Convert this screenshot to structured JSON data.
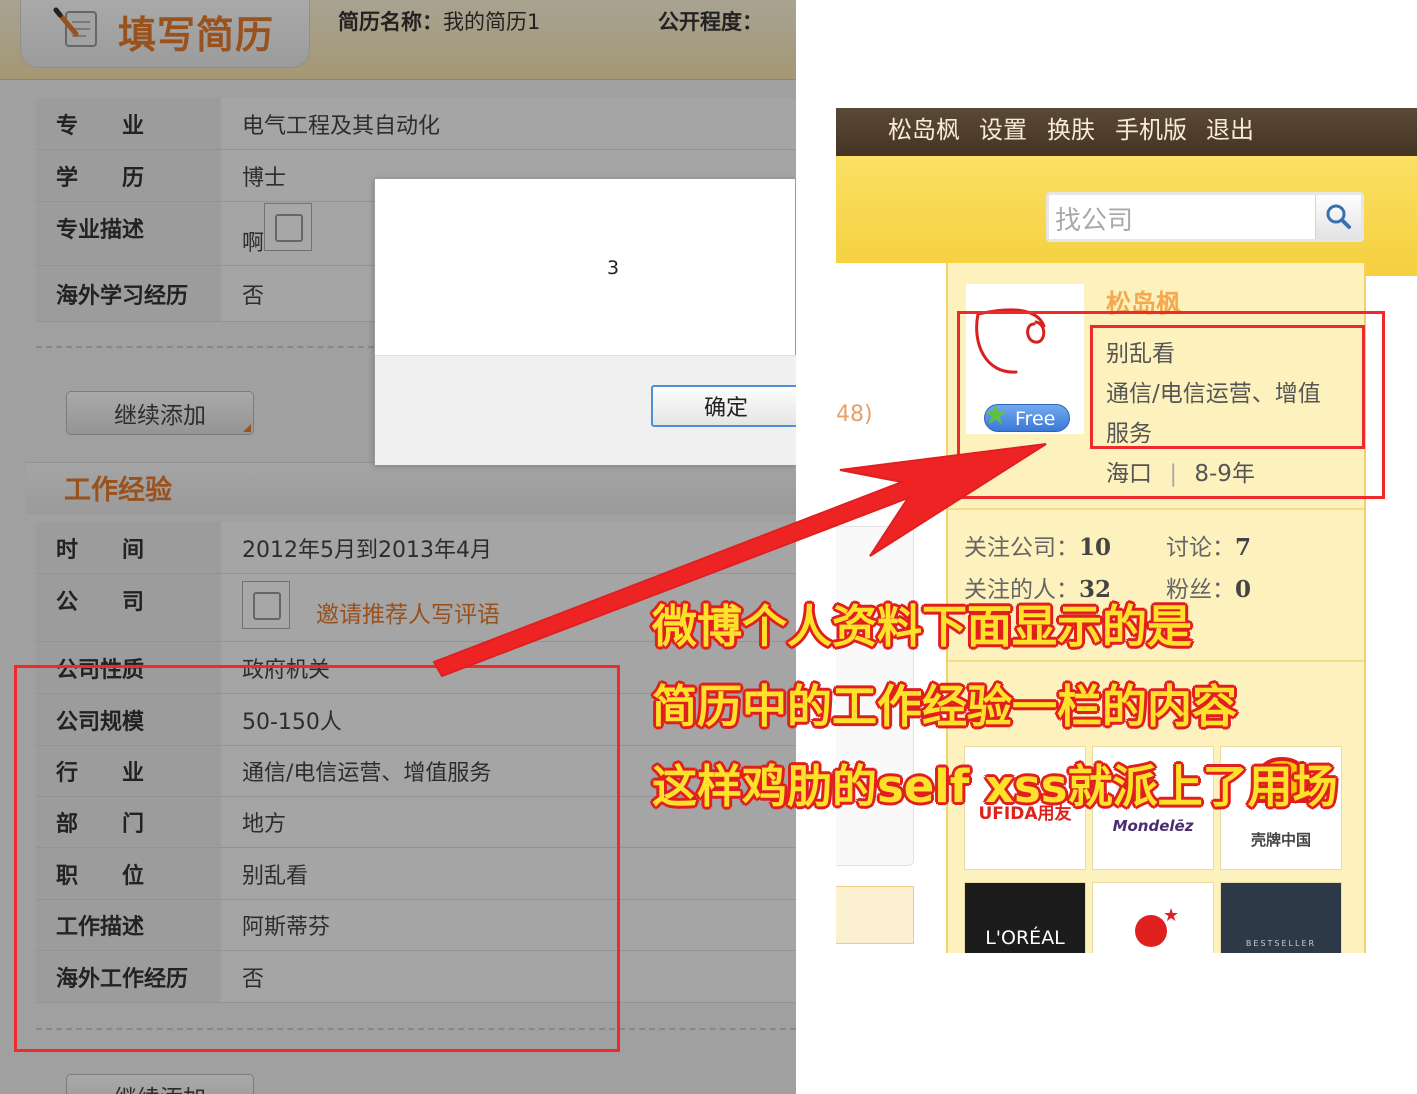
{
  "resume_form": {
    "header": {
      "title": "填写简历",
      "resume_name_label": "简历名称：",
      "resume_name_value": "我的简历1",
      "public_level_label": "公开程度："
    },
    "education_rows": [
      {
        "label": "专　　业",
        "value": "电气工程及其自动化"
      },
      {
        "label": "学　　历",
        "value": "博士"
      },
      {
        "label": "专业描述",
        "value": "啊"
      },
      {
        "label": "海外学习经历",
        "value": "否"
      }
    ],
    "add_more_label": "继续添加",
    "work_section_title": "工作经验",
    "work_rows": [
      {
        "label": "时　　间",
        "value": "2012年5月到2013年4月"
      },
      {
        "label": "公　　司",
        "value": "邀请推荐人写评语"
      },
      {
        "label": "公司性质",
        "value": "政府机关"
      },
      {
        "label": "公司规模",
        "value": "50-150人"
      },
      {
        "label": "行　　业",
        "value": "通信/电信运营、增值服务"
      },
      {
        "label": "部　　门",
        "value": "地方"
      },
      {
        "label": "职　　位",
        "value": "别乱看"
      },
      {
        "label": "工作描述",
        "value": "阿斯蒂芬"
      },
      {
        "label": "海外工作经历",
        "value": "否"
      }
    ],
    "add_more_label_bottom": "继续添加"
  },
  "alert_dialog": {
    "message": "3",
    "ok_label": "确定"
  },
  "weibo_profile": {
    "nav": [
      "松岛枫",
      "设置",
      "换肤",
      "手机版",
      "退出"
    ],
    "search_placeholder": "找公司",
    "side_number": "48)",
    "free_badge": "Free",
    "user": {
      "name": "松岛枫",
      "position": "别乱看",
      "industry_line1": "通信/电信运营、增值",
      "industry_line2": "服务",
      "location": "海口",
      "separator": "|",
      "experience": "8-9年"
    },
    "stats": [
      {
        "label": "关注公司：",
        "value": "10"
      },
      {
        "label": "讨论：",
        "value": "7"
      },
      {
        "label": "关注的人：",
        "value": "32"
      },
      {
        "label": "粉丝：",
        "value": "0"
      }
    ],
    "company_logos": [
      "UFIDA用友",
      "Mondelēz",
      "壳牌中国",
      "L'ORÉAL",
      "",
      "BESTSELLER"
    ]
  },
  "annotation": {
    "lines": [
      "微博个人资料下面显示的是",
      "简历中的工作经验一栏的内容",
      "这样鸡肋的self xss就派上了用场"
    ],
    "colors": {
      "text": "#fde12b",
      "outline": "#e01f1f",
      "box": "#ee2a2a"
    }
  }
}
